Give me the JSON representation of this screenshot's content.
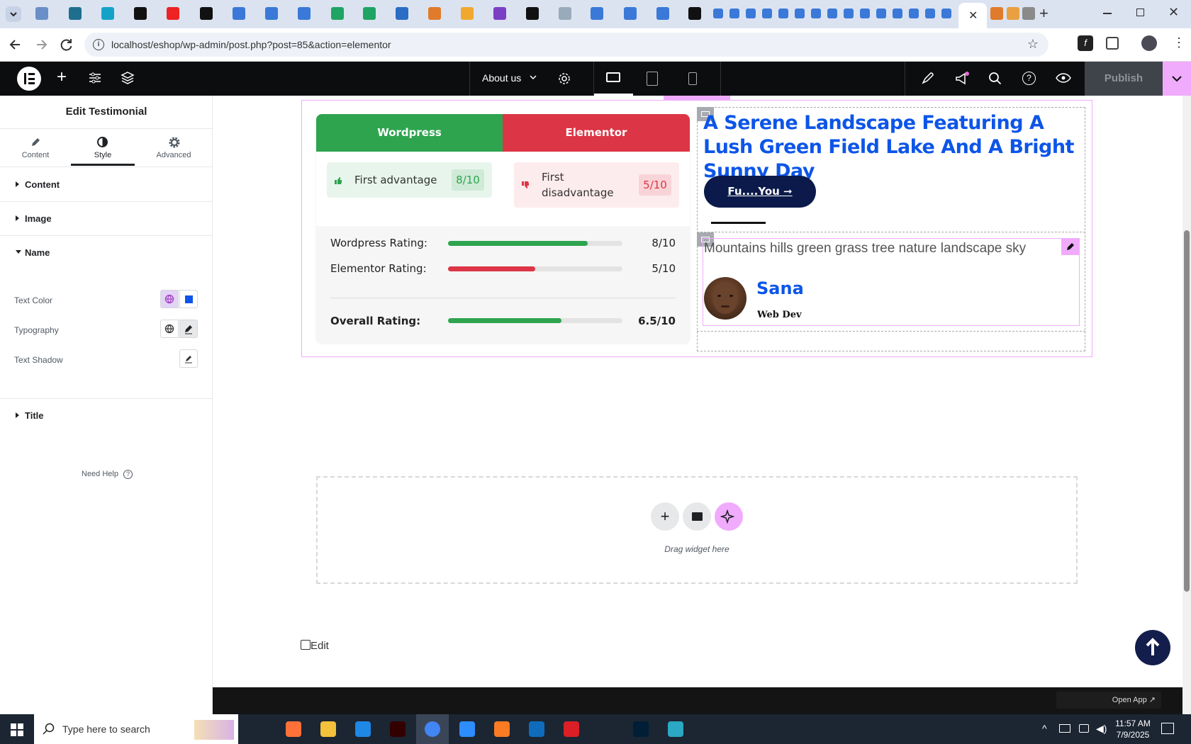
{
  "browser": {
    "url": "localhost/eshop/wp-admin/post.php?post=85&action=elementor",
    "colors": {
      "tabstrip": "#dbe3f1",
      "accent": "#92003b"
    }
  },
  "topbar": {
    "page_name": "About us",
    "publish_label": "Publish"
  },
  "sidebar": {
    "title": "Edit Testimonial",
    "tabs": [
      {
        "label": "Content",
        "icon": "pencil-icon"
      },
      {
        "label": "Style",
        "icon": "half-circle-icon"
      },
      {
        "label": "Advanced",
        "icon": "gear-icon"
      }
    ],
    "active_tab": "Style",
    "sections": {
      "content": "Content",
      "image": "Image",
      "name": "Name",
      "title": "Title"
    },
    "controls": {
      "text_color": "Text Color",
      "typography": "Typography",
      "text_shadow": "Text Shadow",
      "text_color_value": "#0d55e8"
    },
    "need_help": "Need Help"
  },
  "comparison": {
    "tab_left": "Wordpress",
    "tab_right": "Elementor",
    "adv_label": "First advantage",
    "adv_score": "8/10",
    "disadv_label": "First disadvantage",
    "disadv_score": "5/10",
    "ratings": [
      {
        "label": "Wordpress Rating:",
        "value": "8/10",
        "fraction": 0.8,
        "color": "#2ea44f"
      },
      {
        "label": "Elementor Rating:",
        "value": "5/10",
        "fraction": 0.5,
        "color": "#dc3545"
      }
    ],
    "overall": {
      "label": "Overall Rating:",
      "value": "6.5/10",
      "fraction": 0.65,
      "color": "#2ea44f"
    }
  },
  "hero": {
    "heading": "A Serene Landscape Featuring A Lush Green Field Lake And A Bright Sunny Day",
    "button": "Fu....You ➞"
  },
  "testimonial": {
    "text": "Mountains hills green grass tree nature landscape sky",
    "name": "Sana",
    "role": "Web Dev"
  },
  "dropzone": {
    "hint": "Drag widget here"
  },
  "footer": {
    "edit": "Edit",
    "open_app": "Open App ↗"
  },
  "taskbar": {
    "search_placeholder": "Type here to search",
    "time": "11:57 AM",
    "date": "7/9/2025"
  }
}
